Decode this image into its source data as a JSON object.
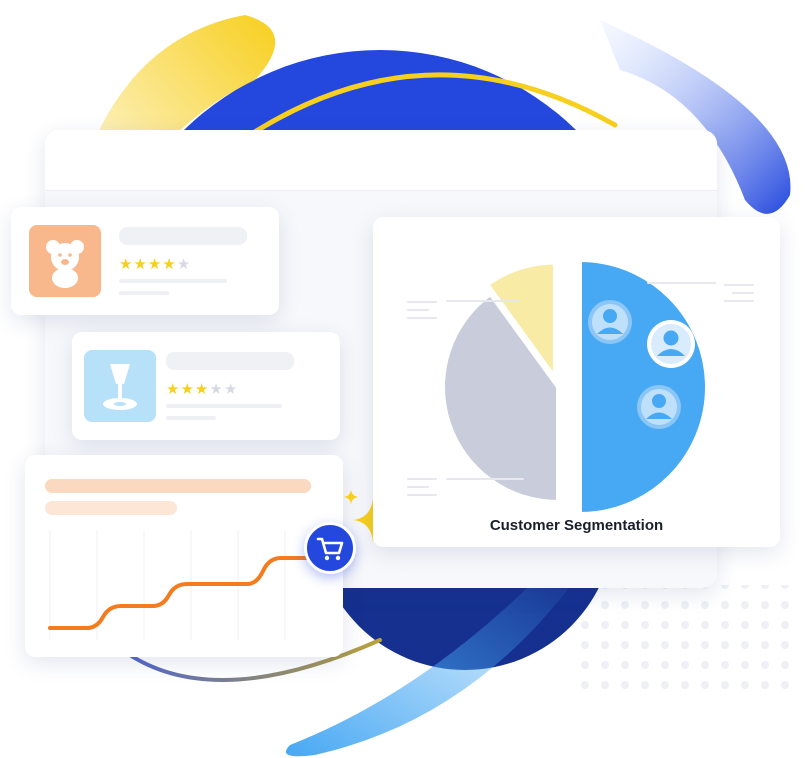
{
  "colors": {
    "brand_blue": "#2448de",
    "navy": "#15308f",
    "yellow": "#f7cf1e",
    "sky": "#47a8f3",
    "orange": "#f47b1e",
    "peach": "#f9b88c",
    "gray_slice": "#c9ccdb",
    "yellow_slice": "#f8eba5"
  },
  "products": [
    {
      "icon": "teddy-bear-icon",
      "rating": 4,
      "max_rating": 5
    },
    {
      "icon": "lamp-icon",
      "rating": 3,
      "max_rating": 5
    }
  ],
  "segmentation": {
    "title": "Customer Segmentation",
    "slices": [
      {
        "label": "",
        "share": 0.1
      },
      {
        "label": "",
        "share": 0.5
      },
      {
        "label": "",
        "share": 0.4
      }
    ]
  },
  "cart_icon": "shopping-cart-icon",
  "sparkle_icon": "sparkle-icon"
}
